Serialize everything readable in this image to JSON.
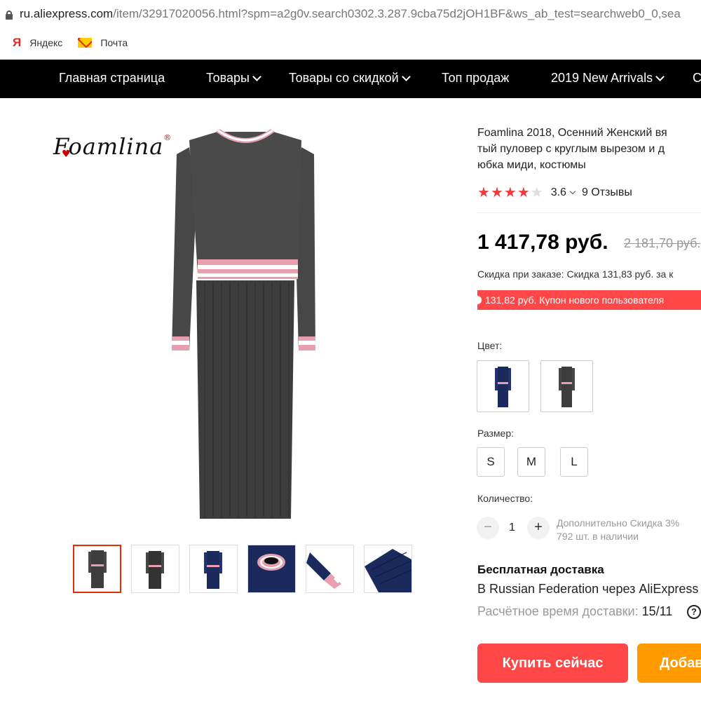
{
  "browser": {
    "url_host": "ru.aliexpress.com",
    "url_path": "/item/32917020056.html?spm=a2g0v.search0302.3.287.9cba75d2jOH1BF&ws_ab_test=searchweb0_0,sea",
    "bookmarks": [
      {
        "label": "Яндекс",
        "icon": "yandex-icon"
      },
      {
        "label": "Почта",
        "icon": "mail-icon"
      }
    ]
  },
  "nav": {
    "home": "Главная страница",
    "goods": "Товары",
    "discounted": "Товары со скидкой",
    "top": "Топ продаж",
    "new": "2019 New Arrivals",
    "more": "С"
  },
  "brand": {
    "name": "Foamlina",
    "mark": "®"
  },
  "product": {
    "title_lines": [
      "Foamlina 2018, Осенний Женский вя",
      "тый пуловер с круглым вырезом и д",
      "юбка миди, костюмы"
    ],
    "rating_value": "3.6",
    "rating_stars": 4,
    "reviews": "9 Отзывы",
    "price": "1 417,78 руб.",
    "old_price": "2 181,70 руб.",
    "discount_text": "Скидка при заказе: Скидка 131,83 руб. за к",
    "coupon_text": "131,82 руб. Купон нового пользователя",
    "color_label": "Цвет:",
    "size_label": "Размер:",
    "sizes": [
      "S",
      "M",
      "L"
    ],
    "quantity_label": "Количество:",
    "quantity_minus": "−",
    "quantity": "1",
    "quantity_plus": "+",
    "extra_discount": "Дополнительно Скидка 3%",
    "stock": "792 шт. в наличии",
    "shipping_title": "Бесплатная доставка",
    "shipping_sub": "В Russian Federation через AliExpress",
    "delivery_label": "Расчётное время доставки:",
    "delivery_date": "15/11",
    "help": "?",
    "buy": "Купить сейчас",
    "add": "Добав"
  },
  "colors": {
    "accent": "#ff4747",
    "cart": "#ff9900",
    "nav_bg": "#000000",
    "knit": "#3a3a3a",
    "navy": "#1a2a5c",
    "stripe_pink": "#e8a0b0"
  }
}
